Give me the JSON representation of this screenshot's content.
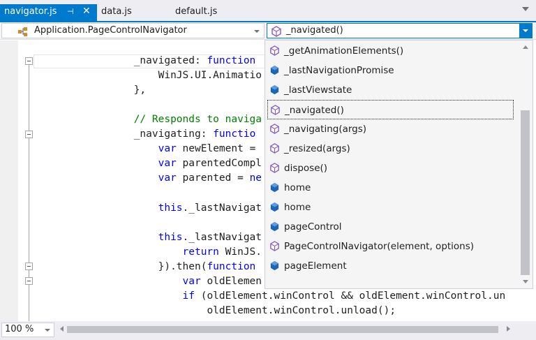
{
  "tabs": [
    {
      "label": "navigator.js",
      "active": true,
      "pin_glyph": "⊣",
      "close_glyph": "✕"
    },
    {
      "label": "data.js",
      "active": false
    },
    {
      "label": "default.js",
      "active": false
    }
  ],
  "navbar": {
    "type_combo": {
      "label": "Application.PageControlNavigator",
      "icon": "class-icon"
    },
    "member_combo": {
      "label": "_navigated()",
      "icon": "method-icon"
    }
  },
  "code_lines": [
    {
      "indent": "                ",
      "parts": [
        {
          "t": "_navigated: ",
          "c": ""
        },
        {
          "t": "function",
          "c": "kw"
        }
      ]
    },
    {
      "indent": "                    ",
      "parts": [
        {
          "t": "WinJS.UI.Animatio",
          "c": ""
        }
      ]
    },
    {
      "indent": "                ",
      "parts": [
        {
          "t": "},",
          "c": ""
        }
      ]
    },
    {
      "indent": "",
      "parts": [
        {
          "t": "",
          "c": ""
        }
      ]
    },
    {
      "indent": "                ",
      "parts": [
        {
          "t": "// Responds to naviga",
          "c": "cm"
        }
      ]
    },
    {
      "indent": "                ",
      "parts": [
        {
          "t": "_navigating: ",
          "c": ""
        },
        {
          "t": "functio",
          "c": "kw"
        }
      ]
    },
    {
      "indent": "                    ",
      "parts": [
        {
          "t": "var",
          "c": "kw"
        },
        {
          "t": " newElement =",
          "c": ""
        }
      ]
    },
    {
      "indent": "                    ",
      "parts": [
        {
          "t": "var",
          "c": "kw"
        },
        {
          "t": " parentedCompl",
          "c": ""
        }
      ]
    },
    {
      "indent": "                    ",
      "parts": [
        {
          "t": "var",
          "c": "kw"
        },
        {
          "t": " parented = ",
          "c": ""
        },
        {
          "t": "ne",
          "c": "kw"
        }
      ]
    },
    {
      "indent": "",
      "parts": [
        {
          "t": "",
          "c": ""
        }
      ]
    },
    {
      "indent": "                    ",
      "parts": [
        {
          "t": "this",
          "c": "kw"
        },
        {
          "t": "._lastNavigat",
          "c": ""
        }
      ]
    },
    {
      "indent": "",
      "parts": [
        {
          "t": "",
          "c": ""
        }
      ]
    },
    {
      "indent": "                    ",
      "parts": [
        {
          "t": "this",
          "c": "kw"
        },
        {
          "t": "._lastNavigat",
          "c": ""
        }
      ]
    },
    {
      "indent": "                        ",
      "parts": [
        {
          "t": "return",
          "c": "kw"
        },
        {
          "t": " WinJS.",
          "c": ""
        }
      ]
    },
    {
      "indent": "                    ",
      "parts": [
        {
          "t": "}).then(",
          "c": ""
        },
        {
          "t": "function",
          "c": "kw"
        }
      ]
    },
    {
      "indent": "                        ",
      "parts": [
        {
          "t": "var",
          "c": "kw"
        },
        {
          "t": " oldElemen",
          "c": ""
        }
      ]
    },
    {
      "indent": "                        ",
      "parts": [
        {
          "t": "if",
          "c": "kw"
        },
        {
          "t": " (oldElement.winControl && oldElement.winControl.un",
          "c": ""
        }
      ]
    },
    {
      "indent": "                            ",
      "parts": [
        {
          "t": "oldElement.winControl.unload();",
          "c": ""
        }
      ]
    }
  ],
  "completion": {
    "items": [
      {
        "label": "_getAnimationElements()",
        "icon": "method-icon",
        "selected": false
      },
      {
        "label": "_lastNavigationPromise",
        "icon": "field-icon",
        "selected": false
      },
      {
        "label": "_lastViewstate",
        "icon": "field-icon",
        "selected": false
      },
      {
        "label": "_navigated()",
        "icon": "method-icon",
        "selected": true
      },
      {
        "label": "_navigating(args)",
        "icon": "method-icon",
        "selected": false
      },
      {
        "label": "_resized(args)",
        "icon": "method-icon",
        "selected": false
      },
      {
        "label": "dispose()",
        "icon": "method-icon",
        "selected": false
      },
      {
        "label": "home",
        "icon": "field-icon",
        "selected": false
      },
      {
        "label": "home",
        "icon": "field-icon",
        "selected": false
      },
      {
        "label": "pageControl",
        "icon": "field-icon",
        "selected": false
      },
      {
        "label": "PageControlNavigator(element, options)",
        "icon": "method-icon",
        "selected": false
      },
      {
        "label": "pageElement",
        "icon": "field-icon",
        "selected": false
      }
    ]
  },
  "statusbar": {
    "zoom": "100 %"
  },
  "colors": {
    "accent": "#007acc",
    "keyword": "#0000ff",
    "comment": "#008000",
    "method_icon": "#8a5fc3",
    "field_icon": "#1f65b5",
    "class_icon": "#d18a2f"
  }
}
